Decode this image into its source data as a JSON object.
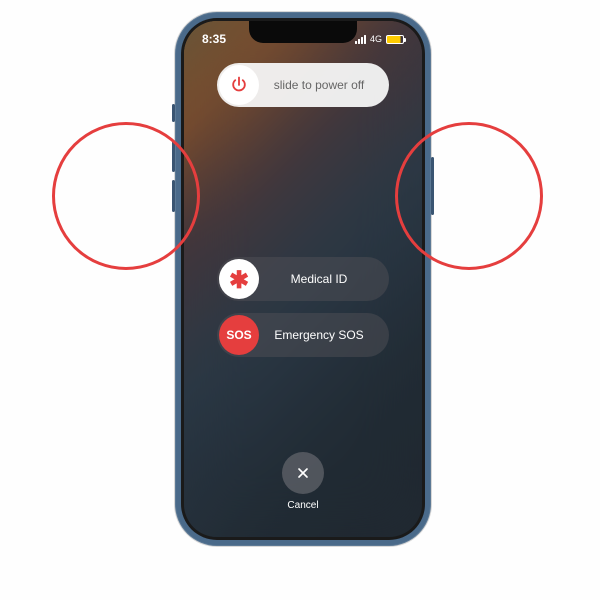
{
  "statusbar": {
    "time": "8:35",
    "network": "4G"
  },
  "sliders": {
    "power": "slide to power off",
    "medical": "Medical ID",
    "sos": "Emergency SOS",
    "sosKnob": "SOS"
  },
  "cancel": {
    "label": "Cancel"
  }
}
